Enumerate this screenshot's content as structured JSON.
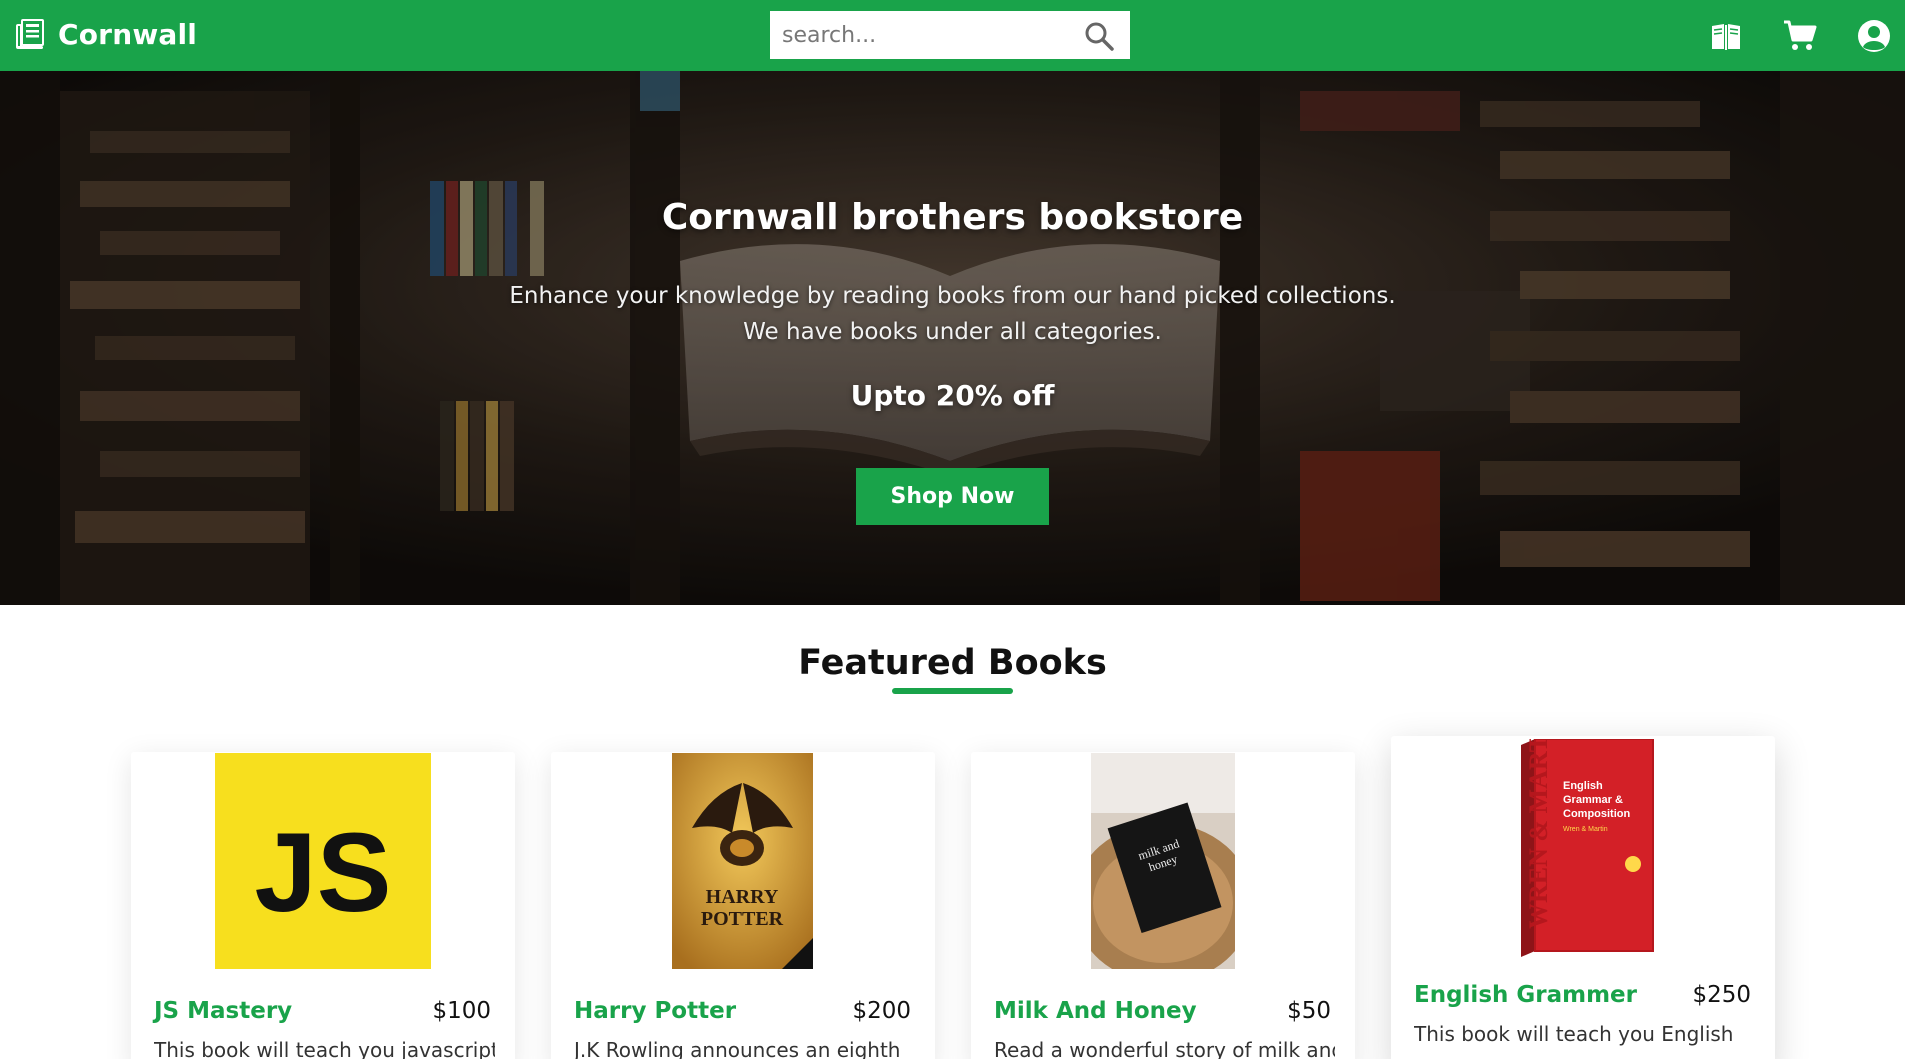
{
  "navbar": {
    "brand": "Cornwall",
    "search_placeholder": "search...",
    "search_value": "",
    "bg_color": "#19a34a"
  },
  "hero": {
    "title": "Cornwall brothers bookstore",
    "line1": "Enhance your knowledge by reading books from our hand picked collections.",
    "line2": "We have books under all categories.",
    "offer": "Upto 20% off",
    "cta": "Shop Now"
  },
  "featured": {
    "heading": "Featured Books",
    "books": [
      {
        "title": "JS Mastery",
        "price": "$100",
        "desc": "This book will teach you javascript",
        "cover_text": "JS",
        "cover_color": "#f7df1e"
      },
      {
        "title": "Harry Potter",
        "price": "$200",
        "desc": "J.K Rowling announces an eighth",
        "cover_text": "HARRY POTTER",
        "cover_color": "#c9912f"
      },
      {
        "title": "Milk And Honey",
        "price": "$50",
        "desc": "Read a wonderful story of milk and",
        "cover_text": "milk and honey",
        "cover_color": "#111111"
      },
      {
        "title": "English Grammer",
        "price": "$250",
        "desc": "This book will teach you English",
        "cover_text": "English Grammar & Composition",
        "cover_color": "#d32027"
      }
    ]
  },
  "icons": {
    "brand": "newspaper-icon",
    "search": "search-icon",
    "book": "open-book-icon",
    "cart": "cart-icon",
    "account": "user-circle-icon"
  }
}
